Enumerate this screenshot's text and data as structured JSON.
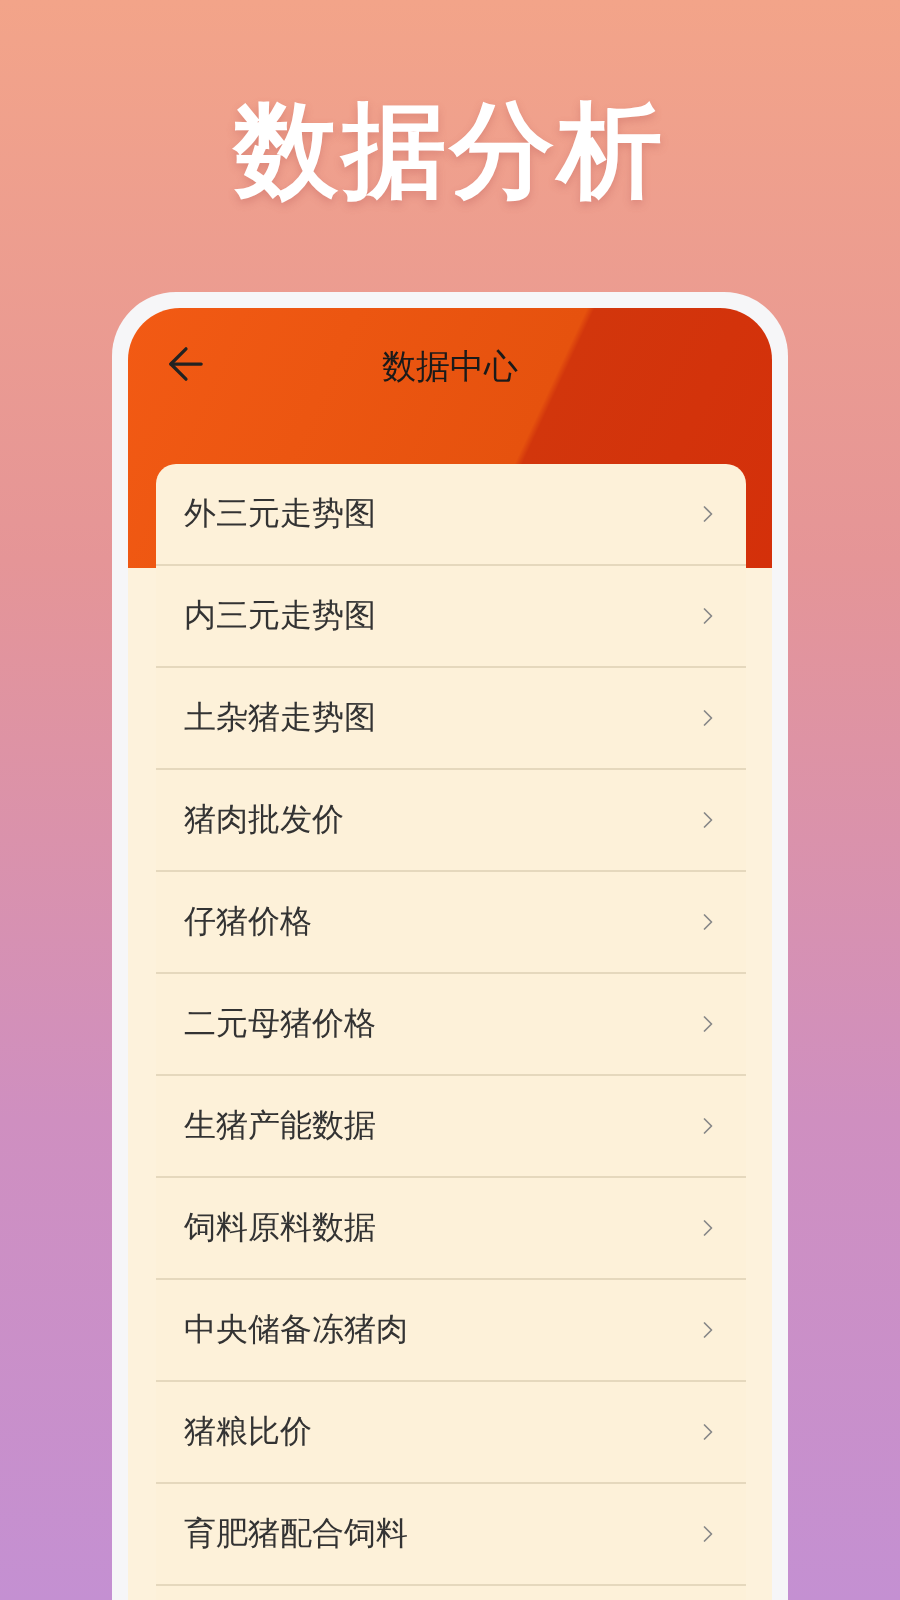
{
  "headline": "数据分析",
  "screen": {
    "title": "数据中心",
    "items": [
      "外三元走势图",
      "内三元走势图",
      "土杂猪走势图",
      "猪肉批发价",
      "仔猪价格",
      "二元母猪价格",
      "生猪产能数据",
      "饲料原料数据",
      "中央储备冻猪肉",
      "猪粮比价",
      "育肥猪配合饲料"
    ]
  }
}
